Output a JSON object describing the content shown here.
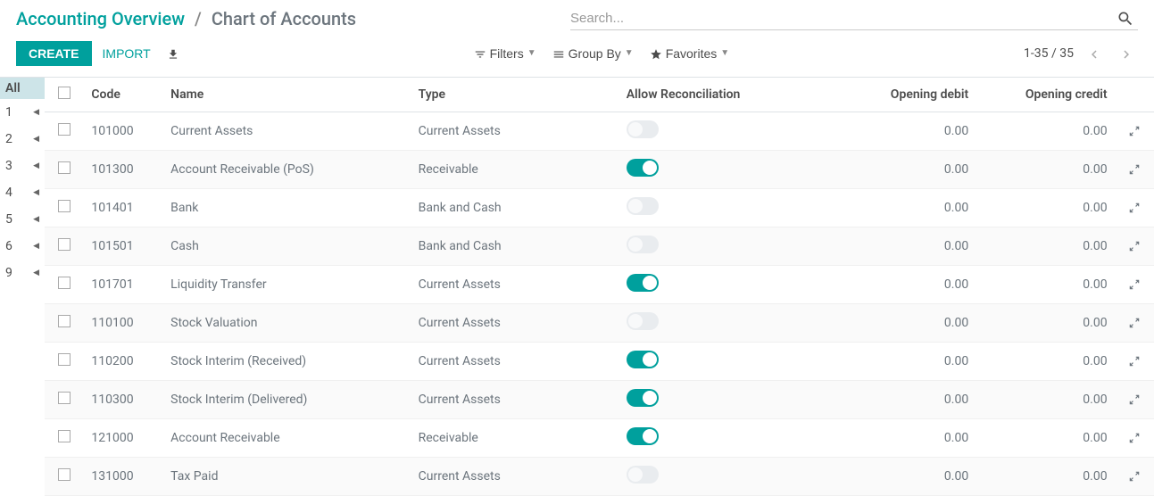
{
  "breadcrumb": {
    "parent": "Accounting Overview",
    "current": "Chart of Accounts"
  },
  "search": {
    "placeholder": "Search..."
  },
  "buttons": {
    "create": "CREATE",
    "import": "IMPORT"
  },
  "filters": {
    "filters": "Filters",
    "groupby": "Group By",
    "favorites": "Favorites"
  },
  "pager": {
    "range": "1-35 / 35"
  },
  "index": {
    "all": "All",
    "items": [
      "1",
      "2",
      "3",
      "4",
      "5",
      "6",
      "9"
    ]
  },
  "columns": {
    "code": "Code",
    "name": "Name",
    "type": "Type",
    "recon": "Allow Reconciliation",
    "debit": "Opening debit",
    "credit": "Opening credit"
  },
  "rows": [
    {
      "code": "101000",
      "name": "Current Assets",
      "type": "Current Assets",
      "recon": false,
      "debit": "0.00",
      "credit": "0.00"
    },
    {
      "code": "101300",
      "name": "Account Receivable (PoS)",
      "type": "Receivable",
      "recon": true,
      "debit": "0.00",
      "credit": "0.00"
    },
    {
      "code": "101401",
      "name": "Bank",
      "type": "Bank and Cash",
      "recon": false,
      "debit": "0.00",
      "credit": "0.00"
    },
    {
      "code": "101501",
      "name": "Cash",
      "type": "Bank and Cash",
      "recon": false,
      "debit": "0.00",
      "credit": "0.00"
    },
    {
      "code": "101701",
      "name": "Liquidity Transfer",
      "type": "Current Assets",
      "recon": true,
      "debit": "0.00",
      "credit": "0.00"
    },
    {
      "code": "110100",
      "name": "Stock Valuation",
      "type": "Current Assets",
      "recon": false,
      "debit": "0.00",
      "credit": "0.00"
    },
    {
      "code": "110200",
      "name": "Stock Interim (Received)",
      "type": "Current Assets",
      "recon": true,
      "debit": "0.00",
      "credit": "0.00"
    },
    {
      "code": "110300",
      "name": "Stock Interim (Delivered)",
      "type": "Current Assets",
      "recon": true,
      "debit": "0.00",
      "credit": "0.00"
    },
    {
      "code": "121000",
      "name": "Account Receivable",
      "type": "Receivable",
      "recon": true,
      "debit": "0.00",
      "credit": "0.00"
    },
    {
      "code": "131000",
      "name": "Tax Paid",
      "type": "Current Assets",
      "recon": false,
      "debit": "0.00",
      "credit": "0.00"
    }
  ]
}
